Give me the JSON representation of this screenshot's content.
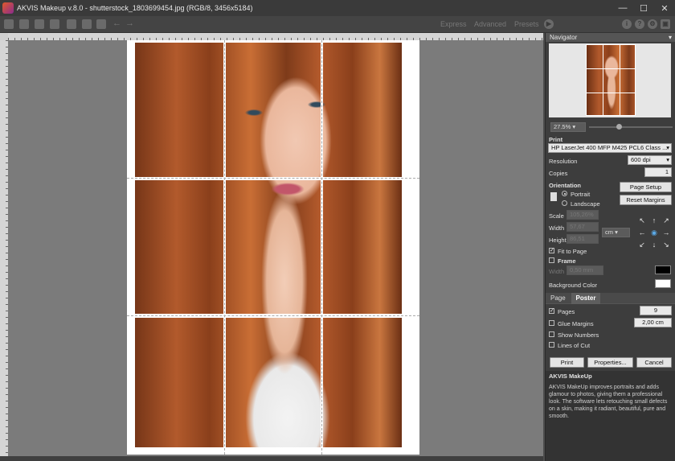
{
  "window": {
    "title": "AKVIS Makeup v.8.0 - shutterstock_1803699454.jpg (RGB/8, 3456x5184)",
    "minimize": "—",
    "maximize": "☐",
    "close": "✕"
  },
  "toolbar": {
    "modes": [
      "Express",
      "Advanced",
      "Presets"
    ],
    "icons": [
      "open-icon",
      "save-icon",
      "share-icon",
      "print-icon",
      "batch-icon",
      "before-icon",
      "after-icon",
      "undo-icon",
      "redo-icon"
    ],
    "right_icons": [
      "i",
      "?",
      "⚙",
      "▣"
    ]
  },
  "navigator": {
    "title": "Navigator",
    "zoom": "27.5%",
    "zoom_level": 0.35
  },
  "print": {
    "title": "Print",
    "printer": "HP LaserJet 400 MFP M425 PCL6 Class ...",
    "resolution_label": "Resolution",
    "resolution": "600 dpi",
    "copies_label": "Copies",
    "copies": "1",
    "orientation_label": "Orientation",
    "portrait": "Portrait",
    "landscape": "Landscape",
    "page_setup": "Page Setup",
    "reset_margins": "Reset Margins",
    "scale_label": "Scale",
    "scale": "105,26%",
    "width_label": "Width",
    "width": "57,67",
    "height_label": "Height",
    "height": "86,51",
    "unit": "cm",
    "fit_to_page": "Fit to Page",
    "frame": "Frame",
    "frame_width_label": "Width",
    "frame_width": "0,50 mm",
    "bg_color_label": "Background Color",
    "frame_color": "#000000",
    "bg_color": "#ffffff",
    "tabs": [
      "Page",
      "Poster"
    ],
    "pages_label": "Pages",
    "pages": "9",
    "glue_label": "Glue Margins",
    "glue": "2,00 cm",
    "show_numbers": "Show Numbers",
    "lines_of_cut": "Lines of Cut",
    "print_btn": "Print",
    "properties_btn": "Properties...",
    "cancel_btn": "Cancel"
  },
  "info": {
    "title": "AKVIS MakeUp",
    "text": "AKVIS MakeUp improves portraits and adds glamour to photos, giving them a professional look. The software lets retouching small defects on a skin, making it radiant, beautiful, pure and smooth."
  }
}
